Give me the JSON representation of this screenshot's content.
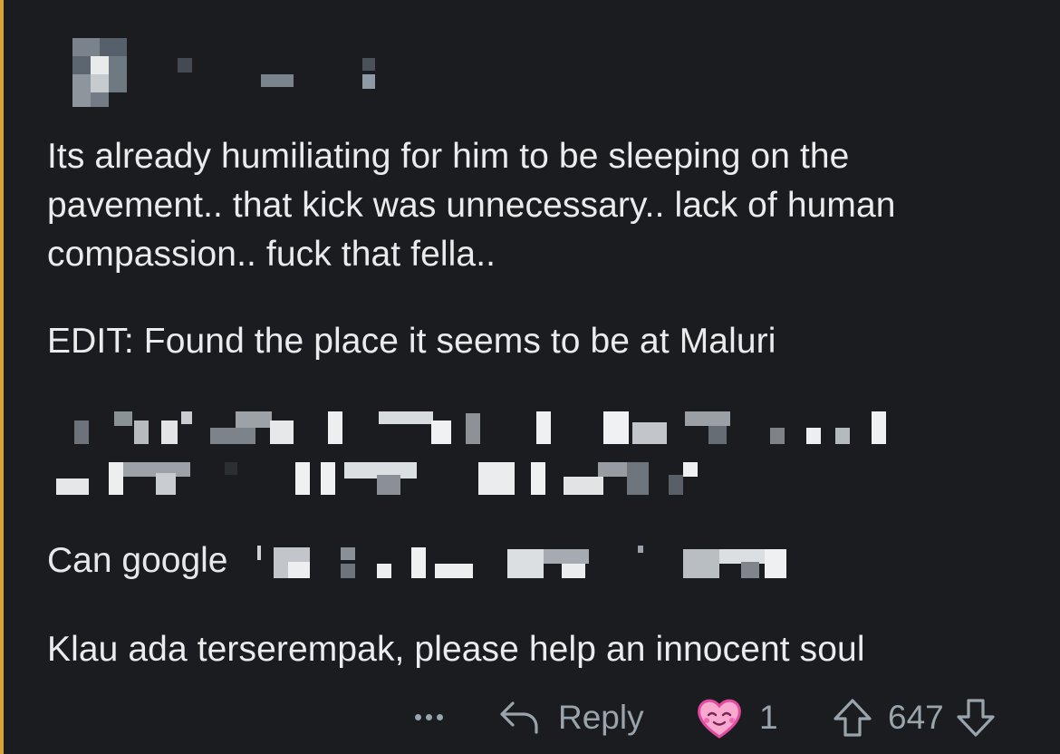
{
  "colors": {
    "background": "#1a1c1f",
    "thread_line": "#d7a43a",
    "text": "#e9ebed",
    "muted": "#9aa4ad"
  },
  "comment": {
    "paragraphs": [
      "Its already humiliating for him to be sleeping on the pavement.. that kick was unnecessary.. lack of human compassion.. fuck that fella..",
      "EDIT: Found the place it seems to be at Maluri",
      "Can google",
      "Klau ada terserempak, please help an innocent soul"
    ]
  },
  "actions": {
    "more_icon": "ellipsis-icon",
    "reply_icon": "reply-arrow-icon",
    "reply_label": "Reply",
    "award_icon": "heart-face-award-icon",
    "award_count": "1",
    "upvote_icon": "upvote-arrow-icon",
    "vote_count": "647",
    "downvote_icon": "downvote-arrow-icon"
  }
}
